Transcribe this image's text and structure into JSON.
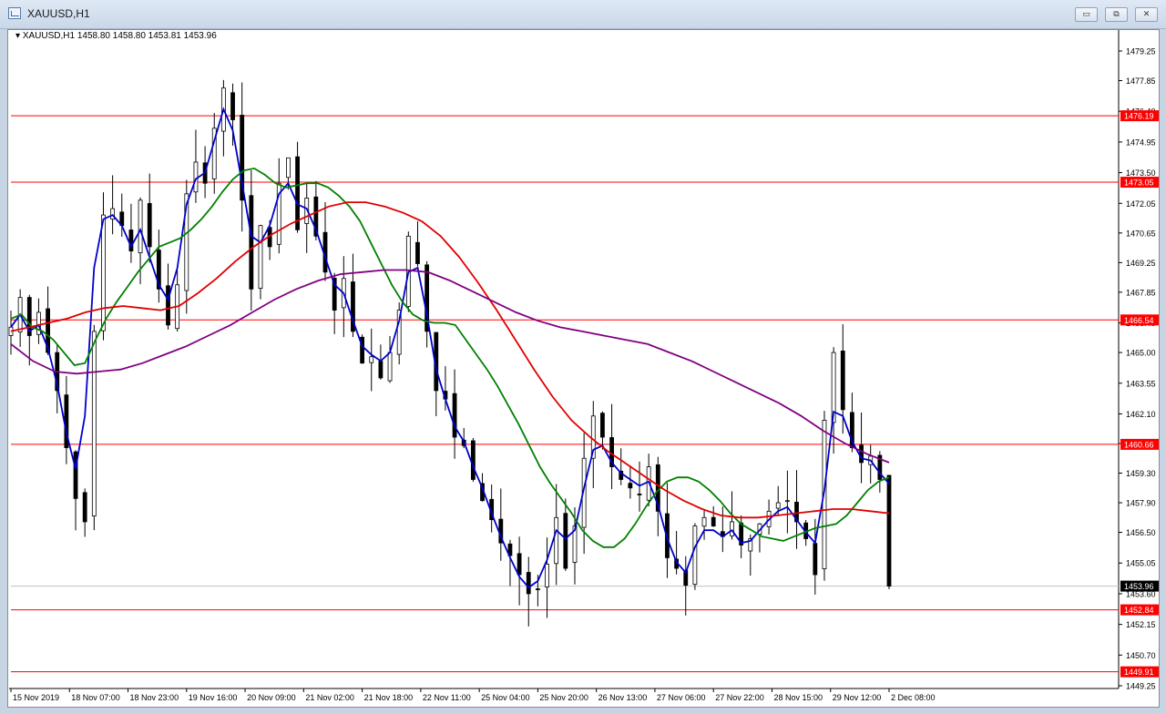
{
  "window": {
    "title": "XAUUSD,H1",
    "min_glyph": "▭",
    "max_glyph": "⧉",
    "close_glyph": "✕"
  },
  "chart_header": {
    "symbol_line": "XAUUSD,H1  1458.80 1458.80 1453.81 1453.96",
    "dropdown_glyph": "▾"
  },
  "colors": {
    "candle": "#000000",
    "level_line": "#ff0000",
    "ma_fast": "#0000cc",
    "ma_mid": "#008000",
    "ma_slow": "#e00000",
    "ma_long": "#800080",
    "current_price_tag": "#000000"
  },
  "chart_data": {
    "type": "candlestick",
    "symbol": "XAUUSD",
    "timeframe": "H1",
    "ohlc_last": {
      "open": 1458.8,
      "high": 1458.8,
      "low": 1453.81,
      "close": 1453.96
    },
    "ylim": [
      1449.25,
      1480.0
    ],
    "y_ticks": [
      "1479.25",
      "1477.85",
      "1476.40",
      "1474.95",
      "1473.50",
      "1472.05",
      "1470.65",
      "1469.25",
      "1467.85",
      "1466.40",
      "1465.00",
      "1463.55",
      "1462.10",
      "1460.70",
      "1459.30",
      "1457.90",
      "1456.50",
      "1455.05",
      "1453.60",
      "1452.15",
      "1450.70",
      "1449.25"
    ],
    "x_ticks": [
      "15 Nov 2019",
      "18 Nov 07:00",
      "18 Nov 23:00",
      "19 Nov 16:00",
      "20 Nov 09:00",
      "21 Nov 02:00",
      "21 Nov 18:00",
      "22 Nov 11:00",
      "25 Nov 04:00",
      "25 Nov 20:00",
      "26 Nov 13:00",
      "27 Nov 06:00",
      "27 Nov 22:00",
      "28 Nov 15:00",
      "29 Nov 12:00",
      "2 Dec 08:00"
    ],
    "levels": [
      {
        "price": 1476.19,
        "label": "1476.19"
      },
      {
        "price": 1473.05,
        "label": "1473.05"
      },
      {
        "price": 1466.54,
        "label": "1466.54"
      },
      {
        "price": 1460.66,
        "label": "1460.66"
      },
      {
        "price": 1452.84,
        "label": "1452.84"
      },
      {
        "price": 1449.91,
        "label": "1449.91"
      }
    ],
    "current_price": {
      "price": 1453.96,
      "label": "1453.96"
    },
    "close_path": [
      1466.2,
      1467.6,
      1465.8,
      1466.9,
      1465.0,
      1463.2,
      1460.5,
      1458.1,
      1457.0,
      1466.0,
      1471.5,
      1471.8,
      1471.0,
      1469.8,
      1472.2,
      1470.0,
      1468.0,
      1466.3,
      1468.2,
      1472.5,
      1474.0,
      1473.0,
      1475.6,
      1477.5,
      1476.0,
      1472.2,
      1468.0,
      1471.0,
      1470.0,
      1473.0,
      1474.2,
      1470.8,
      1472.3,
      1470.5,
      1468.8,
      1467.0,
      1468.5,
      1466.0,
      1464.5,
      1464.8,
      1463.8,
      1465.0,
      1467.0,
      1470.5,
      1469.2,
      1466.0,
      1463.2,
      1462.8,
      1461.0,
      1460.6,
      1459.0,
      1458.0,
      1457.1,
      1456.0,
      1455.4,
      1454.5,
      1453.6,
      1453.8,
      1455.0,
      1457.2,
      1454.8,
      1456.8,
      1460.0,
      1462.0,
      1461.0,
      1459.6,
      1459.0,
      1458.6,
      1458.3,
      1459.6,
      1457.5,
      1455.3,
      1454.8,
      1454.0,
      1456.8,
      1457.2,
      1456.8,
      1456.3,
      1457.0,
      1455.9,
      1456.2,
      1456.9,
      1457.5,
      1457.9,
      1458.0,
      1457.0,
      1456.2,
      1454.5,
      1461.8,
      1465.0,
      1462.3,
      1460.5,
      1459.8,
      1460.1,
      1459.0,
      1453.96
    ],
    "series": [
      {
        "name": "",
        "color": "#0000cc",
        "values": [
          1466.2,
          1466.8,
          1466.0,
          1466.3,
          1465.2,
          1463.5,
          1461.2,
          1459.5,
          1462.0,
          1469.0,
          1471.3,
          1471.5,
          1471.0,
          1470.0,
          1470.8,
          1469.5,
          1468.2,
          1467.5,
          1469.0,
          1472.0,
          1473.2,
          1473.5,
          1475.0,
          1476.5,
          1475.5,
          1473.0,
          1470.5,
          1470.2,
          1471.0,
          1472.5,
          1473.0,
          1472.0,
          1471.8,
          1470.8,
          1469.5,
          1468.2,
          1467.8,
          1466.5,
          1465.3,
          1464.9,
          1464.6,
          1465.0,
          1466.5,
          1468.8,
          1469.0,
          1466.8,
          1464.2,
          1462.8,
          1461.5,
          1460.8,
          1459.6,
          1458.6,
          1457.4,
          1456.3,
          1455.3,
          1454.4,
          1453.9,
          1454.2,
          1455.2,
          1456.6,
          1456.2,
          1456.6,
          1458.6,
          1460.4,
          1460.6,
          1459.8,
          1459.3,
          1459.0,
          1458.7,
          1458.9,
          1457.8,
          1456.2,
          1455.1,
          1454.6,
          1455.8,
          1456.6,
          1456.6,
          1456.3,
          1456.6,
          1456.0,
          1456.1,
          1456.6,
          1457.1,
          1457.5,
          1457.7,
          1457.1,
          1456.5,
          1456.0,
          1458.5,
          1462.2,
          1462.0,
          1460.8,
          1460.0,
          1459.9,
          1459.3,
          1458.8
        ]
      },
      {
        "name": "",
        "color": "#008000",
        "values": [
          1466.6,
          1466.8,
          1466.2,
          1466.0,
          1465.6,
          1465.0,
          1464.4,
          1464.5,
          1465.6,
          1466.6,
          1467.4,
          1468.1,
          1468.8,
          1469.4,
          1470.0,
          1470.2,
          1470.4,
          1470.8,
          1471.3,
          1471.9,
          1472.6,
          1473.2,
          1473.6,
          1473.7,
          1473.4,
          1473.0,
          1472.8,
          1472.9,
          1473.0,
          1473.0,
          1472.8,
          1472.4,
          1471.9,
          1471.2,
          1470.2,
          1469.2,
          1468.2,
          1467.4,
          1466.8,
          1466.5,
          1466.4,
          1466.4,
          1466.3,
          1465.6,
          1464.9,
          1464.2,
          1463.4,
          1462.5,
          1461.6,
          1460.6,
          1459.6,
          1458.8,
          1458.1,
          1457.4,
          1456.6,
          1456.1,
          1455.8,
          1455.8,
          1456.2,
          1456.9,
          1457.7,
          1458.4,
          1458.9,
          1459.1,
          1459.1,
          1458.9,
          1458.5,
          1458.0,
          1457.4,
          1456.9,
          1456.6,
          1456.3,
          1456.2,
          1456.1,
          1456.3,
          1456.5,
          1456.7,
          1456.8,
          1456.9,
          1457.3,
          1457.9,
          1458.5,
          1458.9,
          1459.1
        ]
      },
      {
        "name": "",
        "color": "#e00000",
        "values": [
          1466.0,
          1466.2,
          1466.4,
          1466.6,
          1466.9,
          1467.1,
          1467.2,
          1467.1,
          1467.0,
          1467.2,
          1467.8,
          1468.5,
          1469.3,
          1470.0,
          1470.6,
          1471.1,
          1471.5,
          1471.9,
          1472.1,
          1472.1,
          1471.9,
          1471.6,
          1471.2,
          1470.5,
          1469.5,
          1468.3,
          1467.0,
          1465.6,
          1464.2,
          1462.9,
          1461.8,
          1461.0,
          1460.3,
          1459.7,
          1459.1,
          1458.5,
          1458.0,
          1457.6,
          1457.3,
          1457.2,
          1457.2,
          1457.3,
          1457.4,
          1457.5,
          1457.6,
          1457.6,
          1457.5,
          1457.4
        ]
      },
      {
        "name": "",
        "color": "#800080",
        "values": [
          1465.4,
          1464.6,
          1464.1,
          1464.0,
          1464.1,
          1464.2,
          1464.5,
          1464.9,
          1465.3,
          1465.8,
          1466.3,
          1466.9,
          1467.5,
          1468.0,
          1468.4,
          1468.7,
          1468.8,
          1468.9,
          1468.9,
          1468.8,
          1468.4,
          1467.9,
          1467.4,
          1466.9,
          1466.5,
          1466.2,
          1466.0,
          1465.8,
          1465.6,
          1465.4,
          1465.0,
          1464.6,
          1464.1,
          1463.6,
          1463.1,
          1462.6,
          1462.0,
          1461.3,
          1460.7,
          1460.2,
          1459.8
        ]
      }
    ],
    "grid": false,
    "legend": "none"
  }
}
